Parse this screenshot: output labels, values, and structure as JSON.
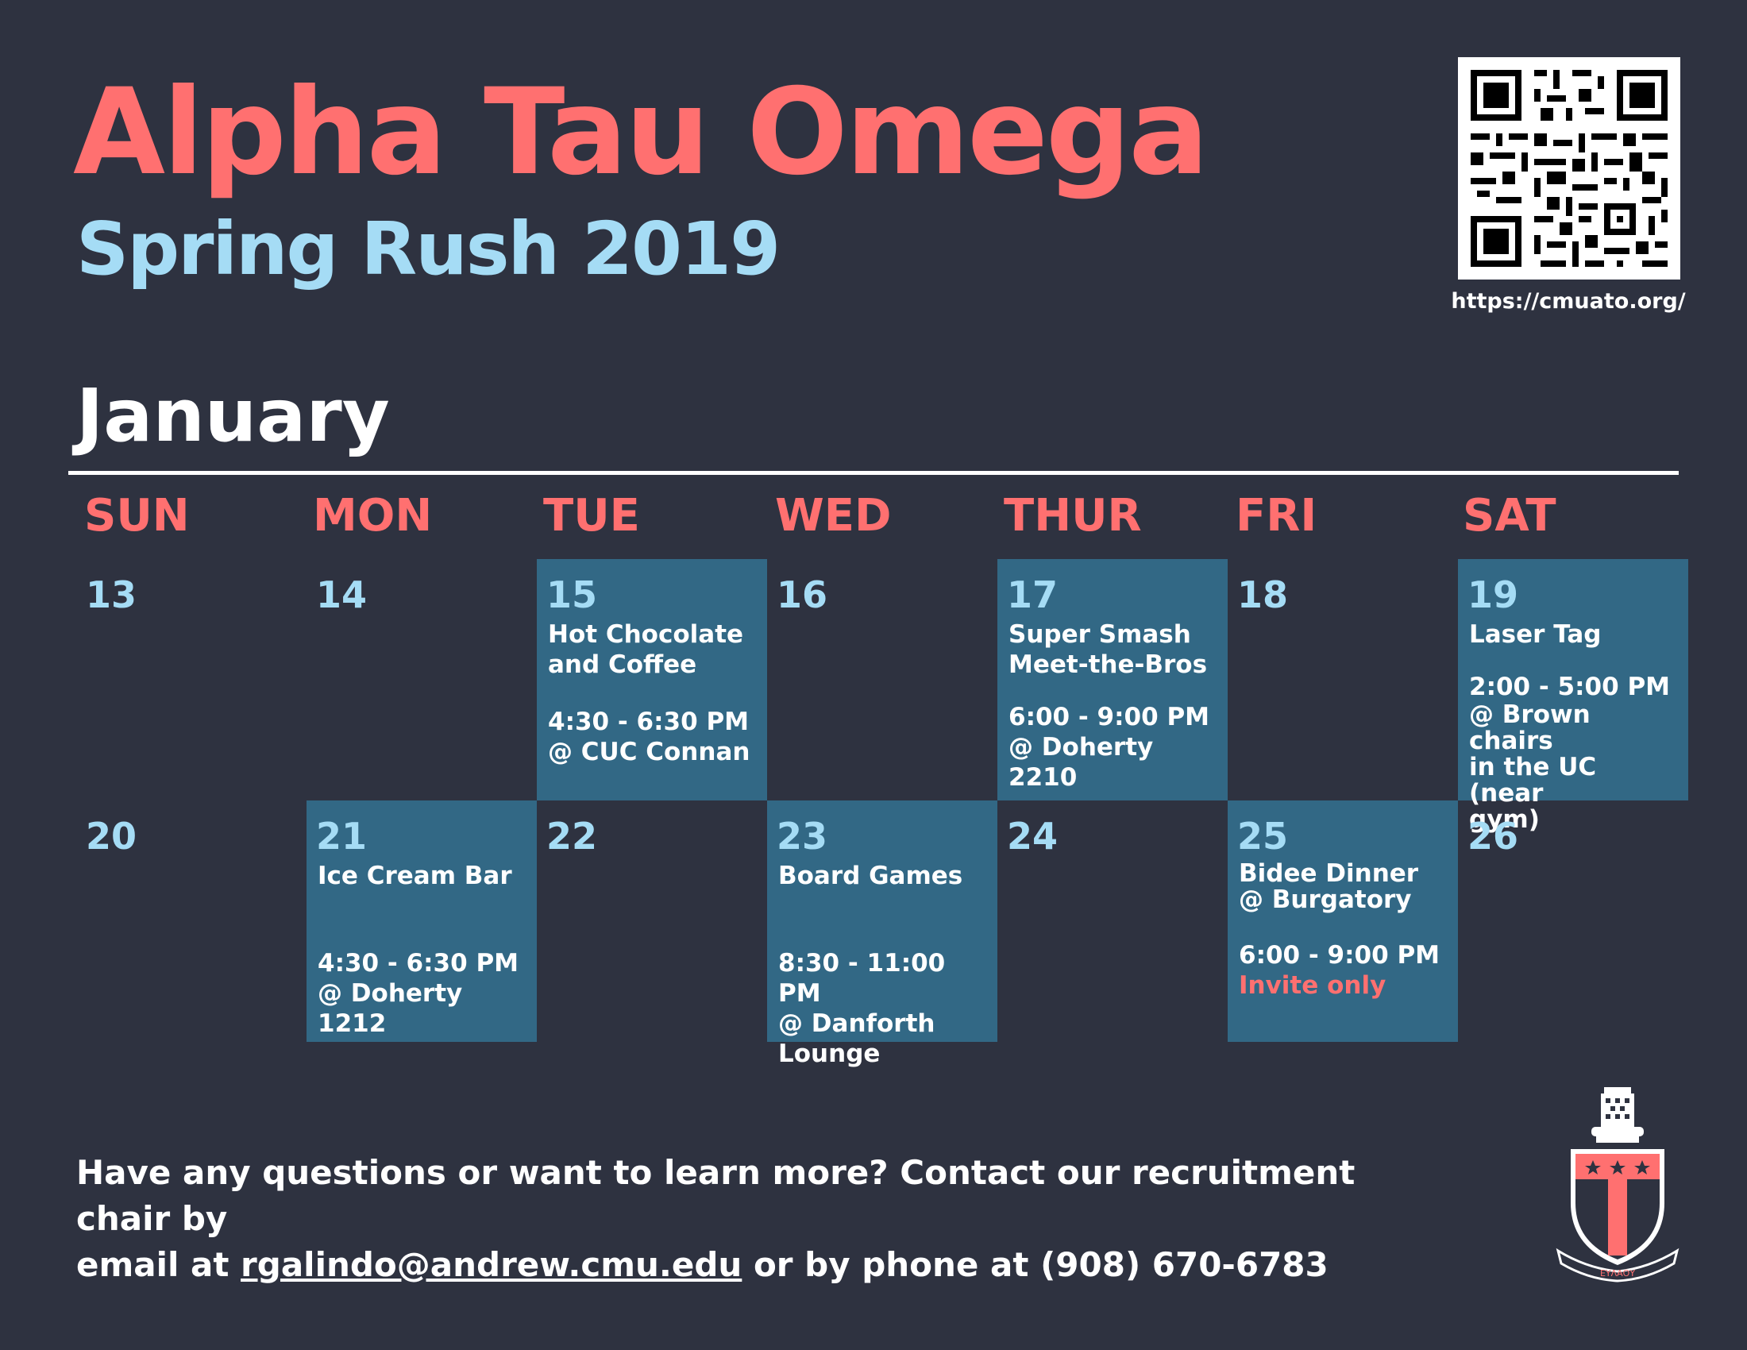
{
  "header": {
    "title": "Alpha Tau Omega",
    "subtitle": "Spring Rush 2019",
    "url": "https://cmuato.org/"
  },
  "calendar": {
    "month": "January",
    "weekdays": [
      "SUN",
      "MON",
      "TUE",
      "WED",
      "THUR",
      "FRI",
      "SAT"
    ],
    "week1": [
      {
        "day": "13"
      },
      {
        "day": "14"
      },
      {
        "day": "15",
        "event": "Hot Chocolate\nand Coffee",
        "time": "4:30 - 6:30 PM",
        "location": "@ CUC Connan"
      },
      {
        "day": "16"
      },
      {
        "day": "17",
        "event": "Super Smash\nMeet-the-Bros",
        "time": "6:00 - 9:00 PM",
        "location": "@ Doherty 2210"
      },
      {
        "day": "18"
      },
      {
        "day": "19",
        "event": "Laser Tag",
        "time": "2:00 - 5:00 PM",
        "location": "@ Brown chairs\nin the UC (near\ngym)"
      }
    ],
    "week2": [
      {
        "day": "20"
      },
      {
        "day": "21",
        "event": "Ice Cream Bar",
        "time": "4:30 - 6:30 PM",
        "location": "@ Doherty 1212"
      },
      {
        "day": "22"
      },
      {
        "day": "23",
        "event": "Board Games",
        "time": "8:30 - 11:00 PM",
        "location": "@ Danforth\nLounge"
      },
      {
        "day": "24"
      },
      {
        "day": "25",
        "event": "Bidee Dinner\n@ Burgatory",
        "time": "6:00 - 9:00 PM",
        "note": "Invite only"
      },
      {
        "day": "26"
      }
    ]
  },
  "footer": {
    "line1": "Have any questions or want to learn more? Contact our recruitment chair by",
    "prefix": "email at ",
    "email": "rgalindo@andrew.cmu.edu",
    "suffix": " or by phone at (908) 670-6783"
  },
  "crest": {
    "motto": "ΕΥΛΑΟΥ"
  },
  "colors": {
    "background": "#2e3240",
    "accent": "#ff7070",
    "light_blue": "#a5dcf5",
    "event_cell": "#326885"
  }
}
